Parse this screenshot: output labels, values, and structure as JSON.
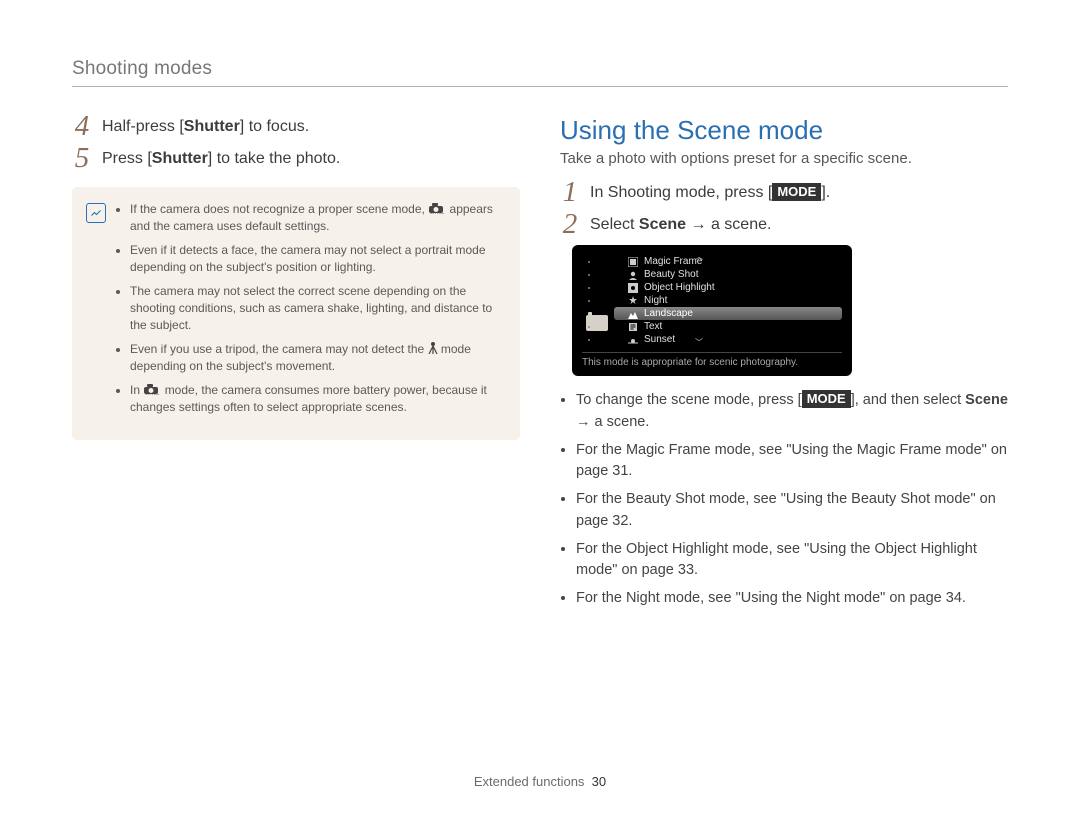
{
  "header": {
    "section": "Shooting modes"
  },
  "left": {
    "steps": {
      "s4": {
        "num": "4",
        "pre": "Half-press [",
        "key": "Shutter",
        "post": "] to focus."
      },
      "s5": {
        "num": "5",
        "pre": "Press [",
        "key": "Shutter",
        "post": "] to take the photo."
      }
    },
    "notes": {
      "n1a": "If the camera does not recognize a proper scene mode, ",
      "n1b": " appears and the camera uses default settings.",
      "n2": "Even if it detects a face, the camera may not select a portrait mode depending on the subject's position or lighting.",
      "n3": "The camera may not select the correct scene depending on the shooting conditions, such as camera shake, lighting, and distance to the subject.",
      "n4a": "Even if you use a tripod, the camera may not detect the ",
      "n4b": " mode depending on the subject's movement.",
      "n5a": "In ",
      "n5b": " mode, the camera consumes more battery power, because it changes settings often to select appropriate scenes."
    }
  },
  "right": {
    "title": "Using the Scene mode",
    "subtitle": "Take a photo with options preset for a specific scene.",
    "steps": {
      "s1": {
        "num": "1",
        "pre": "In Shooting mode, press [",
        "key": "MODE",
        "post": "]."
      },
      "s2": {
        "num": "2",
        "pre": "Select ",
        "key": "Scene",
        "arrow": " → ",
        "post": "a scene."
      }
    },
    "screen": {
      "items": [
        {
          "label": "Magic Frame"
        },
        {
          "label": "Beauty Shot"
        },
        {
          "label": "Object Highlight"
        },
        {
          "label": "Night"
        },
        {
          "label": "Landscape",
          "selected": true
        },
        {
          "label": "Text"
        },
        {
          "label": "Sunset"
        }
      ],
      "desc": "This mode is appropriate for scenic photography."
    },
    "bullets": {
      "b1a": "To change the scene mode, press [",
      "b1key": "MODE",
      "b1b": "], and then select ",
      "b1c": "Scene",
      "b1arrow": " → ",
      "b1d": "a scene.",
      "b2": "For the Magic Frame mode, see \"Using the Magic Frame mode\" on page 31.",
      "b3": "For the Beauty Shot mode, see \"Using the Beauty Shot mode\" on page 32.",
      "b4": "For the Object Highlight mode, see \"Using the Object Highlight mode\" on page 33.",
      "b5": "For the Night mode, see \"Using the Night mode\" on page 34."
    }
  },
  "footer": {
    "section": "Extended functions",
    "page": "30"
  }
}
